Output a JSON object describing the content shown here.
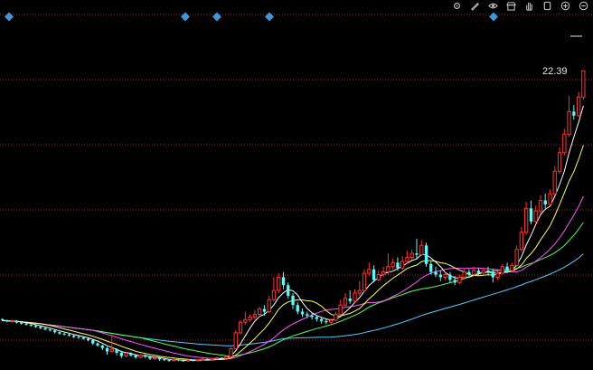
{
  "toolbar": {
    "buttons": [
      {
        "name": "settings-icon"
      },
      {
        "name": "pen-icon"
      },
      {
        "name": "eye-icon"
      },
      {
        "name": "shop-icon"
      },
      {
        "name": "hand-icon"
      },
      {
        "name": "stop-icon"
      },
      {
        "name": "zoom-in-icon"
      },
      {
        "name": "zoom-out-icon"
      }
    ]
  },
  "chart_data": {
    "type": "candlestick",
    "last_price": "22.39",
    "ylim": [
      0,
      25
    ],
    "gridlines": "dotted-red",
    "colors": {
      "up": "#ff3232",
      "down": "#54ffff",
      "ma5": "#ffffff",
      "ma10": "#ffff55",
      "ma20": "#ff55ff",
      "ma30": "#55ff55",
      "ma60": "#55ccff"
    },
    "event_markers": 5,
    "candles": [
      [
        3.62,
        3.55,
        3.7,
        3.48
      ],
      [
        3.55,
        3.45,
        3.6,
        3.4
      ],
      [
        3.45,
        3.5,
        3.58,
        3.38
      ],
      [
        3.5,
        3.38,
        3.55,
        3.3
      ],
      [
        3.38,
        3.3,
        3.45,
        3.22
      ],
      [
        3.3,
        3.22,
        3.35,
        3.15
      ],
      [
        3.22,
        3.15,
        3.28,
        3.05
      ],
      [
        3.15,
        3.05,
        3.2,
        2.98
      ],
      [
        3.05,
        2.95,
        3.1,
        2.88
      ],
      [
        2.95,
        2.85,
        3.0,
        2.78
      ],
      [
        2.85,
        2.78,
        2.92,
        2.7
      ],
      [
        2.78,
        2.65,
        2.85,
        2.55
      ],
      [
        2.65,
        2.55,
        2.72,
        2.45
      ],
      [
        2.55,
        2.48,
        2.6,
        2.4
      ],
      [
        2.48,
        2.4,
        2.55,
        2.32
      ],
      [
        2.4,
        2.3,
        2.48,
        2.2
      ],
      [
        2.3,
        2.25,
        2.38,
        2.15
      ],
      [
        2.25,
        2.15,
        2.32,
        2.08
      ],
      [
        2.15,
        2.05,
        2.22,
        1.95
      ],
      [
        2.05,
        1.8,
        2.1,
        1.7
      ],
      [
        1.8,
        1.65,
        1.88,
        1.55
      ],
      [
        1.65,
        1.45,
        1.7,
        1.3
      ],
      [
        1.45,
        1.2,
        1.55,
        0.95
      ],
      [
        1.2,
        1.35,
        2.5,
        1.15
      ],
      [
        1.35,
        1.1,
        1.45,
        0.9
      ],
      [
        1.1,
        0.85,
        1.25,
        0.7
      ],
      [
        0.85,
        1.05,
        1.15,
        0.75
      ],
      [
        1.05,
        0.9,
        1.15,
        0.8
      ],
      [
        0.9,
        0.75,
        1.0,
        0.65
      ],
      [
        0.75,
        0.9,
        1.0,
        0.7
      ],
      [
        0.9,
        0.8,
        0.98,
        0.7
      ],
      [
        0.8,
        0.65,
        0.88,
        0.55
      ],
      [
        0.65,
        0.72,
        0.8,
        0.58
      ],
      [
        0.72,
        0.6,
        0.78,
        0.5
      ],
      [
        0.6,
        0.55,
        0.68,
        0.48
      ],
      [
        0.55,
        0.5,
        0.62,
        0.42
      ],
      [
        0.5,
        0.58,
        0.65,
        0.45
      ],
      [
        0.58,
        0.52,
        0.64,
        0.46
      ],
      [
        0.52,
        0.48,
        0.58,
        0.42
      ],
      [
        0.48,
        0.54,
        0.6,
        0.44
      ],
      [
        0.54,
        0.5,
        0.58,
        0.45
      ],
      [
        0.5,
        0.56,
        0.62,
        0.46
      ],
      [
        0.56,
        0.62,
        0.68,
        0.52
      ],
      [
        0.62,
        0.58,
        0.66,
        0.54
      ],
      [
        0.58,
        0.66,
        0.72,
        0.55
      ],
      [
        0.66,
        0.72,
        0.78,
        0.62
      ],
      [
        0.72,
        0.68,
        0.76,
        0.64
      ],
      [
        0.68,
        0.8,
        0.86,
        0.66
      ],
      [
        0.8,
        1.4,
        1.5,
        0.78
      ],
      [
        1.4,
        2.6,
        2.8,
        1.35
      ],
      [
        2.6,
        3.4,
        3.55,
        2.5
      ],
      [
        3.4,
        3.6,
        4.2,
        3.2
      ],
      [
        3.6,
        3.8,
        4.0,
        3.4
      ],
      [
        3.8,
        4.0,
        4.3,
        3.6
      ],
      [
        4.0,
        4.4,
        4.55,
        3.8
      ],
      [
        4.4,
        4.2,
        4.7,
        3.9
      ],
      [
        4.2,
        5.1,
        5.4,
        4.1
      ],
      [
        5.1,
        5.8,
        6.8,
        5.0
      ],
      [
        5.8,
        6.8,
        7.1,
        5.6
      ],
      [
        6.8,
        6.2,
        7.2,
        5.9
      ],
      [
        6.2,
        5.4,
        6.4,
        5.2
      ],
      [
        5.4,
        4.7,
        5.6,
        4.4
      ],
      [
        4.7,
        4.2,
        4.9,
        4.0
      ],
      [
        4.2,
        4.0,
        4.45,
        3.8
      ],
      [
        4.0,
        3.9,
        4.2,
        3.7
      ],
      [
        3.9,
        3.8,
        4.1,
        3.6
      ],
      [
        3.8,
        3.65,
        3.95,
        3.45
      ],
      [
        3.65,
        3.5,
        3.8,
        3.3
      ],
      [
        3.5,
        3.4,
        3.65,
        3.25
      ],
      [
        3.4,
        3.55,
        3.7,
        3.3
      ],
      [
        3.55,
        4.0,
        4.2,
        3.5
      ],
      [
        4.0,
        4.7,
        5.1,
        3.9
      ],
      [
        4.7,
        5.2,
        5.6,
        4.6
      ],
      [
        5.2,
        5.0,
        5.8,
        4.8
      ],
      [
        5.0,
        5.6,
        5.9,
        4.9
      ],
      [
        5.6,
        5.8,
        6.5,
        5.4
      ],
      [
        5.8,
        7.1,
        7.4,
        5.7
      ],
      [
        7.1,
        7.4,
        7.9,
        6.9
      ],
      [
        7.4,
        6.6,
        7.7,
        6.4
      ],
      [
        6.6,
        7.0,
        7.3,
        6.5
      ],
      [
        7.0,
        7.2,
        7.6,
        6.8
      ],
      [
        7.2,
        7.6,
        8.6,
        7.0
      ],
      [
        7.6,
        7.9,
        8.2,
        7.4
      ],
      [
        7.9,
        7.5,
        8.3,
        7.3
      ],
      [
        7.5,
        8.0,
        8.4,
        7.4
      ],
      [
        8.0,
        8.3,
        8.8,
        7.8
      ],
      [
        8.3,
        8.6,
        8.9,
        8.1
      ],
      [
        8.6,
        8.5,
        9.7,
        8.2
      ],
      [
        8.5,
        9.2,
        9.6,
        8.4
      ],
      [
        9.2,
        7.8,
        9.4,
        7.6
      ],
      [
        7.8,
        7.2,
        8.0,
        7.0
      ],
      [
        7.2,
        7.0,
        7.6,
        6.8
      ],
      [
        7.0,
        6.8,
        7.3,
        6.5
      ],
      [
        6.8,
        7.0,
        7.2,
        6.6
      ],
      [
        7.0,
        6.6,
        7.2,
        6.4
      ],
      [
        6.6,
        6.4,
        6.9,
        6.2
      ],
      [
        6.4,
        6.8,
        7.0,
        6.3
      ],
      [
        6.8,
        7.2,
        7.5,
        6.7
      ],
      [
        7.2,
        7.0,
        7.4,
        6.8
      ],
      [
        7.0,
        7.3,
        7.6,
        6.9
      ],
      [
        7.3,
        7.1,
        7.5,
        6.9
      ],
      [
        7.1,
        7.3,
        7.5,
        7.0
      ],
      [
        7.3,
        7.2,
        7.6,
        7.0
      ],
      [
        7.2,
        6.8,
        7.4,
        6.4
      ],
      [
        6.8,
        7.1,
        7.3,
        6.6
      ],
      [
        7.1,
        7.6,
        7.8,
        7.0
      ],
      [
        7.6,
        7.3,
        7.9,
        7.1
      ],
      [
        7.3,
        7.7,
        7.9,
        7.2
      ],
      [
        7.7,
        8.9,
        9.2,
        7.6
      ],
      [
        8.9,
        10.2,
        10.6,
        8.7
      ],
      [
        10.2,
        12.0,
        12.5,
        10.0
      ],
      [
        12.0,
        11.0,
        12.6,
        10.8
      ],
      [
        11.0,
        11.8,
        12.2,
        10.9
      ],
      [
        11.8,
        12.6,
        13.0,
        11.6
      ],
      [
        12.6,
        12.3,
        13.1,
        12.0
      ],
      [
        12.3,
        13.1,
        13.4,
        12.2
      ],
      [
        13.1,
        14.8,
        15.2,
        13.0
      ],
      [
        14.8,
        16.2,
        16.6,
        14.6
      ],
      [
        16.2,
        17.6,
        18.0,
        16.0
      ],
      [
        17.6,
        19.3,
        20.5,
        17.4
      ],
      [
        19.3,
        19.0,
        19.8,
        18.7
      ],
      [
        19.0,
        20.4,
        20.8,
        18.9
      ],
      [
        20.4,
        22.39,
        22.39,
        20.2
      ]
    ]
  }
}
